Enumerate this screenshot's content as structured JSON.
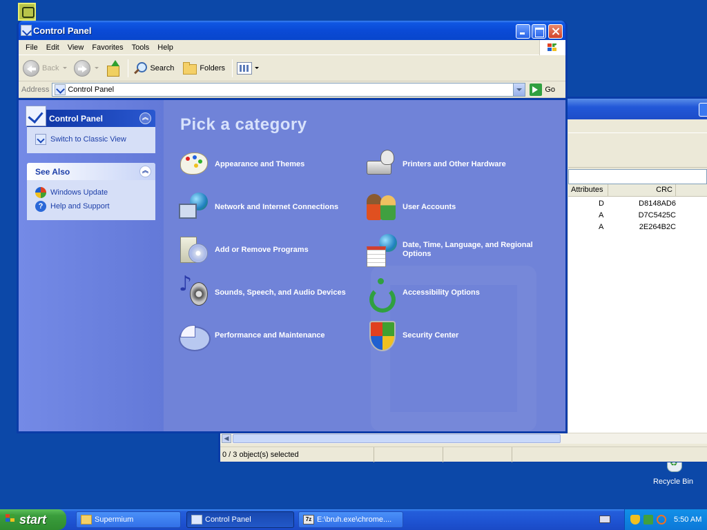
{
  "window": {
    "title": "Control Panel",
    "menu": [
      "File",
      "Edit",
      "View",
      "Favorites",
      "Tools",
      "Help"
    ]
  },
  "toolbar": {
    "back_label": "Back",
    "search_label": "Search",
    "folders_label": "Folders"
  },
  "address": {
    "label": "Address",
    "value": "Control Panel",
    "go_label": "Go"
  },
  "sidebar": {
    "primary_title": "Control Panel",
    "primary_link": "Switch to Classic View",
    "see_also_title": "See Also",
    "see_also_links": [
      "Windows Update",
      "Help and Support"
    ]
  },
  "main": {
    "heading": "Pick a category",
    "categories_left": [
      {
        "label": "Appearance and Themes",
        "icon": "appearance-icon"
      },
      {
        "label": "Network and Internet Connections",
        "icon": "network-icon"
      },
      {
        "label": "Add or Remove Programs",
        "icon": "add-remove-icon"
      },
      {
        "label": "Sounds, Speech, and Audio Devices",
        "icon": "sounds-icon"
      },
      {
        "label": "Performance and Maintenance",
        "icon": "performance-icon"
      }
    ],
    "categories_right": [
      {
        "label": "Printers and Other Hardware",
        "icon": "printer-icon"
      },
      {
        "label": "User Accounts",
        "icon": "users-icon"
      },
      {
        "label": "Date, Time, Language, and Regional Options",
        "icon": "datetime-icon"
      },
      {
        "label": "Accessibility Options",
        "icon": "accessibility-icon"
      },
      {
        "label": "Security Center",
        "icon": "security-icon"
      }
    ]
  },
  "background_window": {
    "columns": [
      "Attributes",
      "CRC"
    ],
    "rows": [
      {
        "attributes": "D",
        "crc": "D8148AD6"
      },
      {
        "attributes": "A",
        "crc": "D7C5425C"
      },
      {
        "attributes": "A",
        "crc": "2E264B2C"
      }
    ],
    "status": "0 / 3 object(s) selected"
  },
  "desktop": {
    "recycle_bin_label": "Recycle Bin"
  },
  "taskbar": {
    "start_label": "start",
    "buttons": [
      "Supermium",
      "Control Panel",
      "E:\\bruh.exe\\chrome...."
    ],
    "clock": "5:50 AM"
  },
  "colors": {
    "title_blue": "#0a4ad6",
    "sidebar_blue": "#6379d8",
    "main_blue": "#7083d8",
    "taskbar_blue": "#245edb",
    "start_green": "#3a9d3c"
  }
}
